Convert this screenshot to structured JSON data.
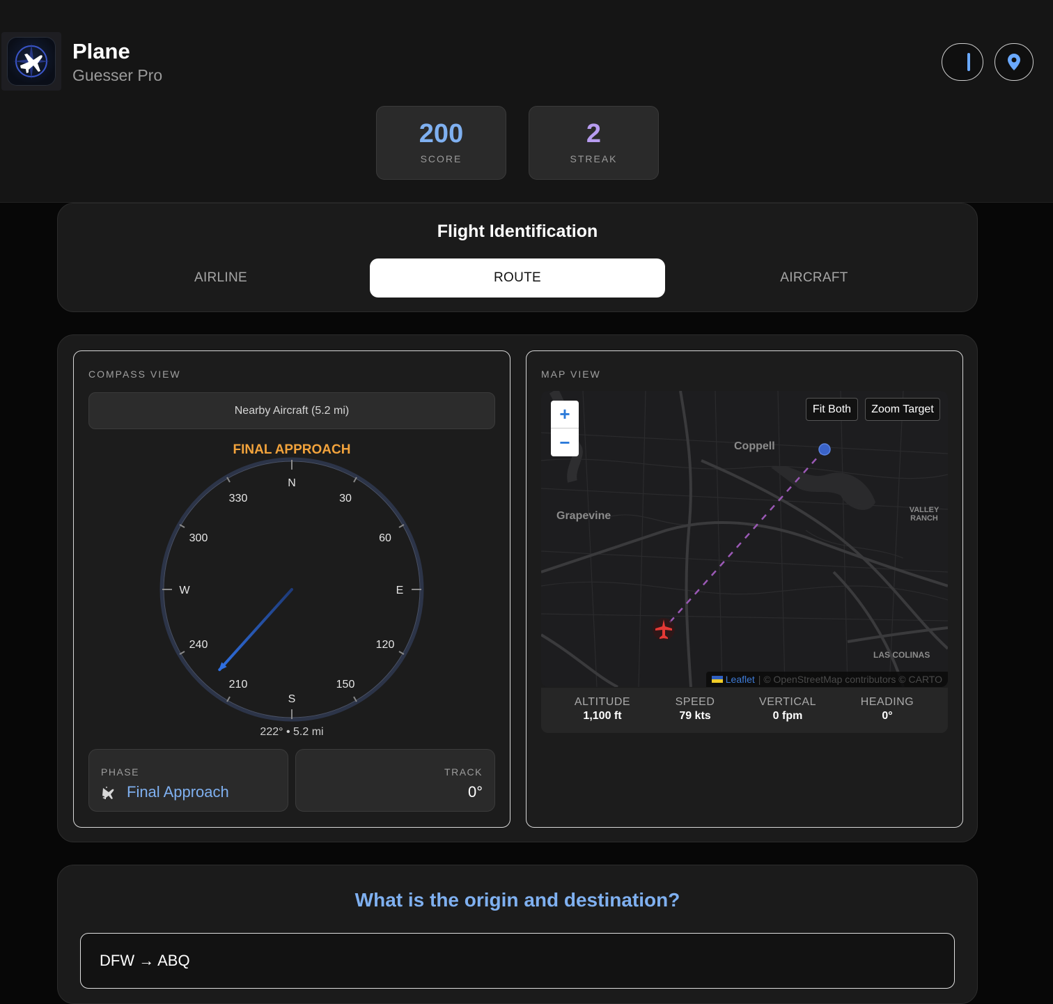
{
  "app": {
    "title": "Plane",
    "subtitle": "Guesser Pro"
  },
  "header": {
    "theme_toggle_icon": "toggle-icon",
    "location_icon": "location-pin-icon"
  },
  "stats": [
    {
      "value": "200",
      "label": "SCORE",
      "color": "#7fb0f0"
    },
    {
      "value": "2",
      "label": "STREAK",
      "color": "#b79cf0"
    }
  ],
  "identification": {
    "title": "Flight Identification",
    "tabs": [
      "AIRLINE",
      "ROUTE",
      "AIRCRAFT"
    ],
    "active_tab": "ROUTE"
  },
  "compass": {
    "label": "COMPASS VIEW",
    "nearby": "Nearby Aircraft (5.2 mi)",
    "phase_title": "FINAL APPROACH",
    "cardinals": {
      "n": "N",
      "e": "E",
      "s": "S",
      "w": "W"
    },
    "degrees": {
      "d30": "30",
      "d60": "60",
      "d120": "120",
      "d150": "150",
      "d210": "210",
      "d240": "240",
      "d300": "300",
      "d330": "330"
    },
    "bearing_value": 222,
    "bearing_text": "222° • 5.2 mi",
    "phase_label": "PHASE",
    "phase_value": "Final Approach",
    "track_label": "TRACK",
    "track_value": "0°"
  },
  "map": {
    "label": "MAP VIEW",
    "zoom_in": "+",
    "zoom_out": "−",
    "fit_both": "Fit Both",
    "zoom_target": "Zoom Target",
    "places": {
      "coppell": "Coppell",
      "grapevine": "Grapevine",
      "valley_ranch": "VALLEY RANCH",
      "las_colinas": "LAS COLINAS"
    },
    "attribution_leaflet": "Leaflet",
    "attribution_rest": "| © OpenStreetMap contributors © CARTO"
  },
  "flight_stats": [
    {
      "label": "ALTITUDE",
      "value": "1,100 ft"
    },
    {
      "label": "SPEED",
      "value": "79 kts"
    },
    {
      "label": "VERTICAL",
      "value": "0 fpm"
    },
    {
      "label": "HEADING",
      "value": "0°"
    }
  ],
  "question": {
    "text": "What is the origin and destination?",
    "answer": "DFW → ABQ"
  },
  "colors": {
    "accent": "#7fb0f0",
    "phase": "#f2a33c",
    "needle": "#2f6fe0",
    "plane_marker": "#e53935",
    "route_line": "#9b59b6"
  }
}
